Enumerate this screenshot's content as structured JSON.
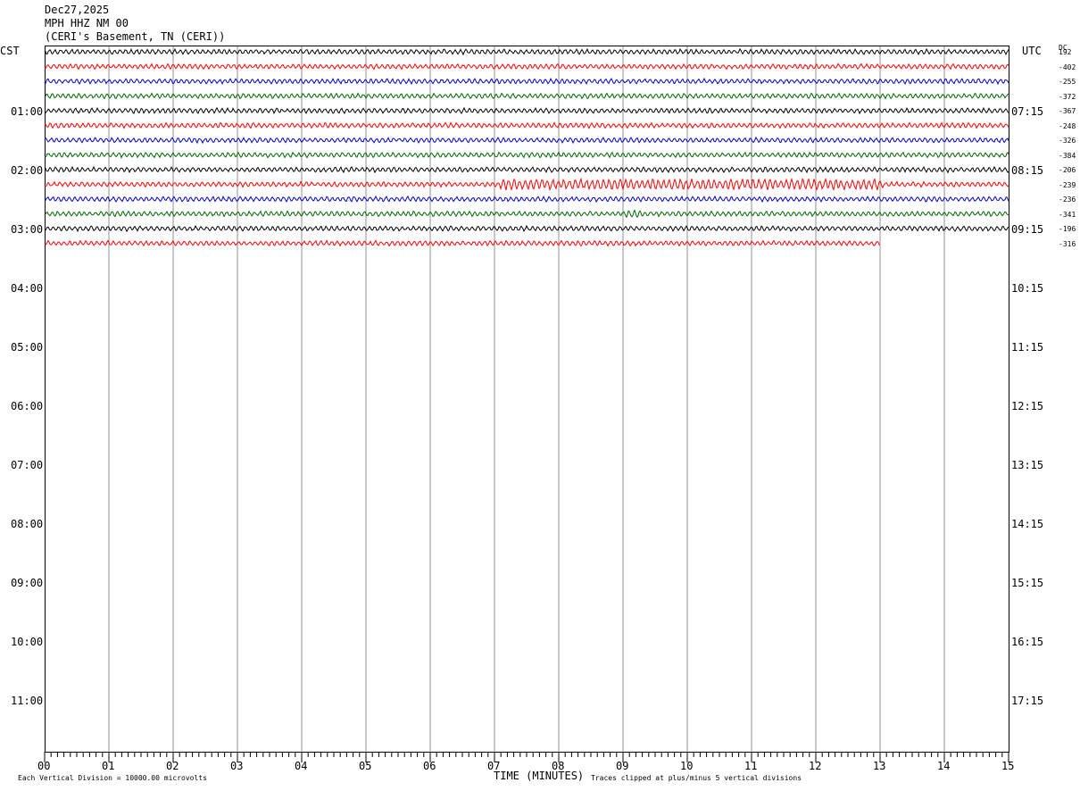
{
  "header": {
    "date": "Dec27,2025",
    "station": "MPH HHZ NM 00",
    "location": "(CERI's Basement, TN (CERI))"
  },
  "labels": {
    "left_zone": "CST",
    "right_zone": "UTC",
    "dc_label": "DC",
    "x_title": "TIME (MINUTES)",
    "footer_left": "Each Vertical Division = 10000.00 microvolts",
    "footer_right": "Traces clipped at plus/minus 5 vertical divisions"
  },
  "chart_data": {
    "type": "helicorder",
    "x_ticks": [
      "00",
      "01",
      "02",
      "03",
      "04",
      "05",
      "06",
      "07",
      "08",
      "09",
      "10",
      "11",
      "12",
      "13",
      "14",
      "15"
    ],
    "xlim": [
      0,
      15
    ],
    "xlabel": "TIME (MINUTES)",
    "left_hour_labels": [
      "01:00",
      "02:00",
      "03:00",
      "04:00",
      "05:00",
      "06:00",
      "07:00",
      "08:00",
      "09:00",
      "10:00",
      "11:00"
    ],
    "right_hour_labels": [
      "07:15",
      "08:15",
      "09:15",
      "10:15",
      "11:15",
      "12:15",
      "13:15",
      "14:15",
      "15:15",
      "16:15",
      "17:15"
    ],
    "trace_colors": [
      "#000000",
      "#ff0000",
      "#0000cc",
      "#006600"
    ],
    "dc_offsets": [
      "192",
      "-402",
      "-255",
      "-372",
      "-367",
      "-248",
      "-326",
      "-384",
      "-206",
      "-239",
      "-236",
      "-341",
      "-196",
      "-316"
    ],
    "last_trace_end_minute": 13,
    "grid": "vertical-minute-lines"
  }
}
